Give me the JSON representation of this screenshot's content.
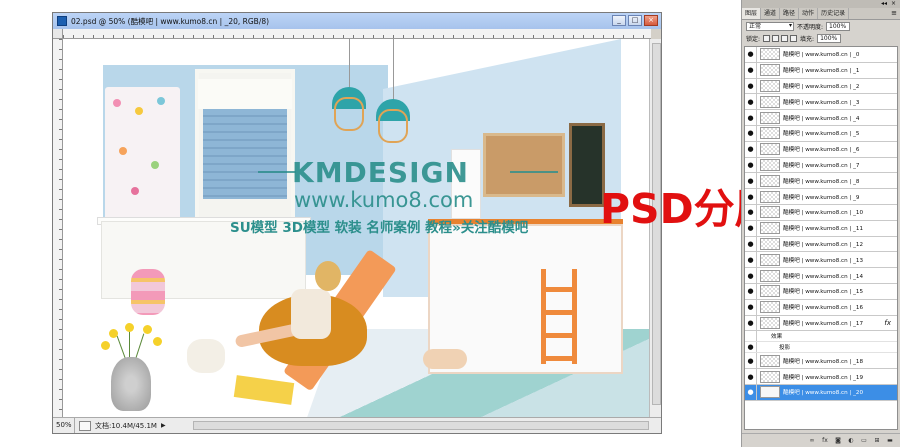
{
  "document": {
    "title": "02.psd @ 50% (酷模吧 | www.kumo8.cn | _20, RGB/8)",
    "zoom": "50%",
    "doc_info": "文档:10.4M/45.1M"
  },
  "window_buttons": {
    "minimize": "_",
    "restore": "□",
    "close": "×"
  },
  "watermark": {
    "brand": "KMDESIGN",
    "url": "www.kumo8.com",
    "slogan": "SU模型 3D模型 软装 名师案例 教程»关注酷模吧",
    "psd_label": "PSD分层"
  },
  "layers_panel": {
    "tabs": [
      "图层",
      "通道",
      "路径",
      "动作",
      "历史记录"
    ],
    "blend_mode": "正常",
    "opacity_label": "不透明度:",
    "opacity_value": "100%",
    "lock_label": "锁定:",
    "fill_label": "填充:",
    "fill_value": "100%",
    "layers": [
      "酷模吧 | www.kumo8.cn | _0",
      "酷模吧 | www.kumo8.cn | _1",
      "酷模吧 | www.kumo8.cn | _2",
      "酷模吧 | www.kumo8.cn | _3",
      "酷模吧 | www.kumo8.cn | _4",
      "酷模吧 | www.kumo8.cn | _5",
      "酷模吧 | www.kumo8.cn | _6",
      "酷模吧 | www.kumo8.cn | _7",
      "酷模吧 | www.kumo8.cn | _8",
      "酷模吧 | www.kumo8.cn | _9",
      "酷模吧 | www.kumo8.cn | _10",
      "酷模吧 | www.kumo8.cn | _11",
      "酷模吧 | www.kumo8.cn | _12",
      "酷模吧 | www.kumo8.cn | _13",
      "酷模吧 | www.kumo8.cn | _14",
      "酷模吧 | www.kumo8.cn | _15",
      "酷模吧 | www.kumo8.cn | _16",
      "酷模吧 | www.kumo8.cn | _17",
      "酷模吧 | www.kumo8.cn | _18",
      "酷模吧 | www.kumo8.cn | _19",
      "酷模吧 | www.kumo8.cn | _20"
    ],
    "effects_label": "效果",
    "effect_item": "投影",
    "fx_badge": "fx",
    "selected_layer": "酷模吧 | www.kumo8.cn | _20"
  },
  "colors": {
    "selected_layer": "#3c8ee6",
    "watermark": "#2c8f8c",
    "psd_label": "#e11010"
  }
}
